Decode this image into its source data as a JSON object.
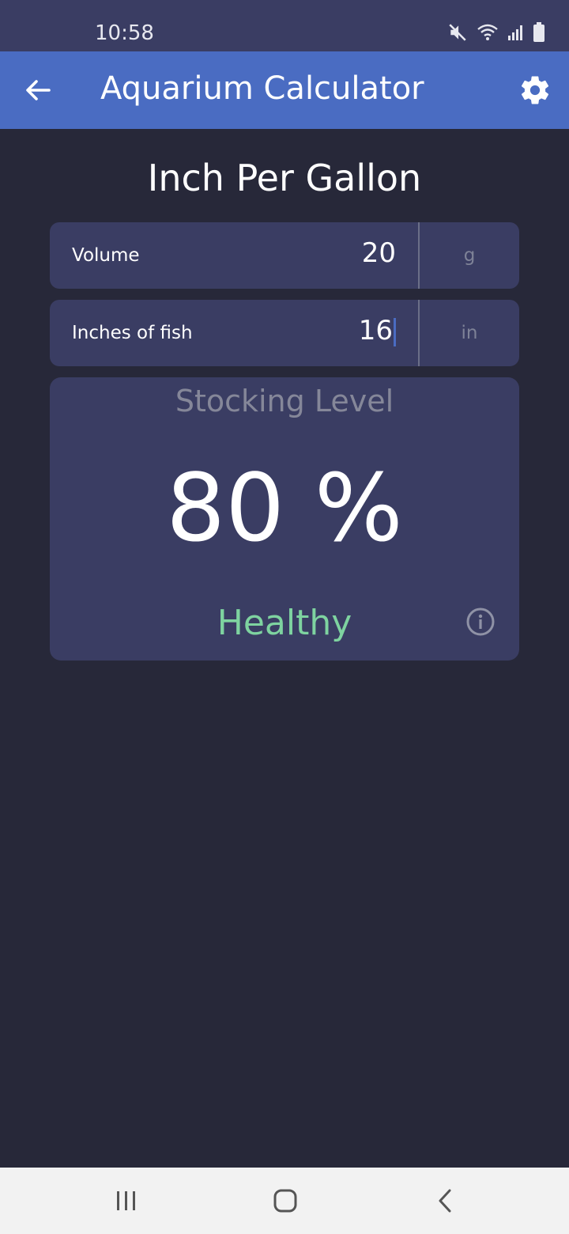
{
  "status_bar": {
    "time": "10:58",
    "icons": [
      "mute-icon",
      "wifi-icon",
      "signal-icon",
      "battery-icon"
    ]
  },
  "app_bar": {
    "title": "Aquarium Calculator",
    "back_icon": "arrow-left-icon",
    "settings_icon": "gear-icon",
    "background": "#4a6cc2"
  },
  "page": {
    "title": "Inch Per Gallon"
  },
  "fields": [
    {
      "label": "Volume",
      "value": "20",
      "unit": "g"
    },
    {
      "label": "Inches of fish",
      "value": "16",
      "unit": "in"
    }
  ],
  "result": {
    "heading": "Stocking Level",
    "value": "80 %",
    "status": "Healthy",
    "status_color": "#7ed3a0",
    "info_icon": "info-icon"
  },
  "nav_bar": {
    "icons": [
      "recent-apps-icon",
      "home-icon",
      "back-icon"
    ]
  }
}
